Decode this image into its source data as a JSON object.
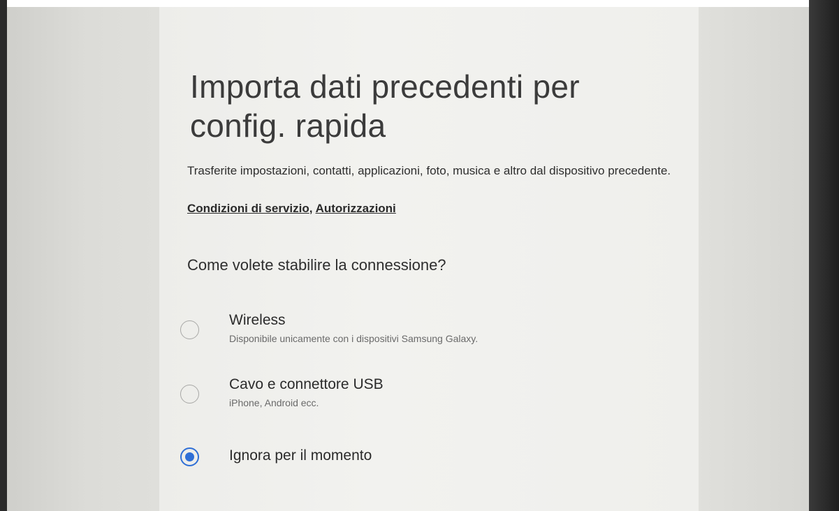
{
  "page": {
    "title": "Importa dati precedenti per config. rapida",
    "description": "Trasferite impostazioni, contatti, applicazioni, foto, musica e altro dal dispositivo precedente.",
    "links": {
      "terms": "Condizioni di servizio",
      "separator": ", ",
      "permissions": "Autorizzazioni"
    },
    "question": "Come volete stabilire la connessione?"
  },
  "options": [
    {
      "label": "Wireless",
      "sublabel": "Disponibile unicamente con i dispositivi Samsung Galaxy.",
      "selected": false
    },
    {
      "label": "Cavo e connettore USB",
      "sublabel": "iPhone, Android ecc.",
      "selected": false
    },
    {
      "label": "Ignora per il momento",
      "sublabel": "",
      "selected": true
    }
  ],
  "colors": {
    "accent": "#2f6fd6",
    "text": "#2e2e2e",
    "subtext": "#6a6a6a"
  }
}
